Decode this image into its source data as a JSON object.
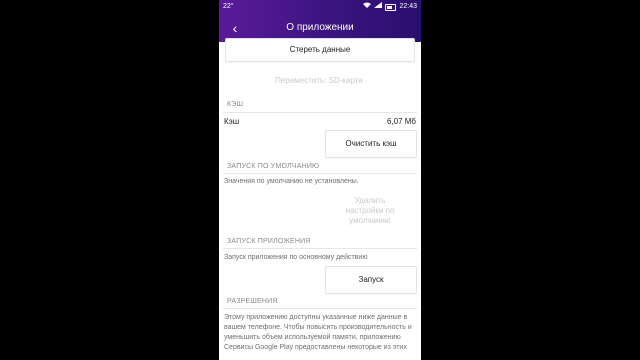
{
  "status_bar": {
    "left_text": "22°",
    "time": "22:43"
  },
  "app_bar": {
    "back_glyph": "‹",
    "title": "О приложении"
  },
  "storage": {
    "clear_data_label": "Стереть данные",
    "move_sd_label": "Переместить: SD-карта"
  },
  "cache": {
    "section_title": "КЭШ",
    "label": "Кэш",
    "value": "6,07 Мб",
    "clear_cache_label": "Очистить кэш"
  },
  "defaults": {
    "section_title": "ЗАПУСК ПО УМОЛЧАНИЮ",
    "status_text": "Значения по умолчанию не установлены.",
    "remove_defaults_label": "Удалить настройки по умолчанию"
  },
  "launch": {
    "section_title": "ЗАПУСК ПРИЛОЖЕНИЯ",
    "description": "Запуск приложения по основному действию",
    "launch_label": "Запуск"
  },
  "permissions": {
    "section_title": "РАЗРЕШЕНИЯ",
    "text": "Этому приложению доступны указанные ниже данные в вашем телефоне. Чтобы повысить производительность и уменьшить объем используемой памяти, приложению Сервисы Google Play предоставлены некоторые из этих"
  }
}
